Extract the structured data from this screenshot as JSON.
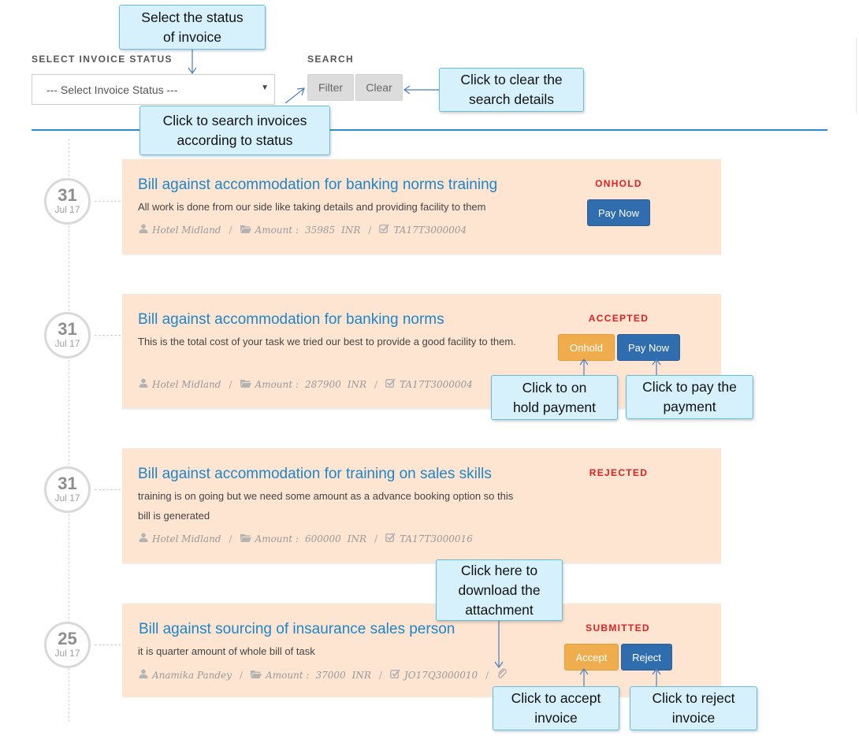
{
  "filters": {
    "status_label": "SELECT INVOICE STATUS",
    "status_select_value": "--- Select Invoice Status ---",
    "search_label": "SEARCH",
    "filter_button": "Filter",
    "clear_button": "Clear"
  },
  "invoices": [
    {
      "day": "31",
      "month": "Jul 17",
      "title": "Bill against accommodation for banking norms training",
      "description": "All work is done from our side like taking details and providing facility to them",
      "vendor": "Hotel Midland",
      "amount_label": "Amount :",
      "amount": "35985",
      "currency": "INR",
      "ref": "TA17T3000004",
      "status": "ONHOLD",
      "actions": [
        "Pay Now"
      ]
    },
    {
      "day": "31",
      "month": "Jul 17",
      "title": "Bill against accommodation for banking norms",
      "description": "This is the total cost of your task we tried our best to provide a good facility to them.",
      "vendor": "Hotel Midland",
      "amount_label": "Amount :",
      "amount": "287900",
      "currency": "INR",
      "ref": "TA17T3000004",
      "status": "ACCEPTED",
      "actions": [
        "Onhold",
        "Pay Now"
      ]
    },
    {
      "day": "31",
      "month": "Jul 17",
      "title": "Bill against accommodation for training on sales skills",
      "description": "training is on going but we need some amount as a advance booking option so this bill is generated",
      "vendor": "Hotel Midland",
      "amount_label": "Amount :",
      "amount": "600000",
      "currency": "INR",
      "ref": "TA17T3000016",
      "status": "REJECTED",
      "actions": []
    },
    {
      "day": "25",
      "month": "Jul 17",
      "title": "Bill against sourcing of insaurance sales person",
      "description": "it is quarter amount of whole bill of task",
      "vendor": "Anamika Pandey",
      "amount_label": "Amount :",
      "amount": "37000",
      "currency": "INR",
      "ref": "JO17Q3000010",
      "status": "SUBMITTED",
      "actions": [
        "Accept",
        "Reject"
      ]
    }
  ],
  "callouts": {
    "select_status": "Select  the status of invoice",
    "search": "Click to search invoices according to status",
    "clear": "Click to clear the search details",
    "onhold": "Click to on hold payment",
    "pay": "Click to pay the payment",
    "download": "Click here to download the attachment",
    "accept": "Click to accept invoice",
    "reject": "Click to reject invoice"
  },
  "colors": {
    "accent_blue": "#1e86c8",
    "card_background": "#fde5d2",
    "status_red": "#e02020",
    "button_blue": "#2f6dae",
    "button_orange": "#efad4e",
    "callout_fill": "#d6f1fb"
  },
  "icons": [
    "user-icon",
    "folder-icon",
    "check-square-icon",
    "paperclip-icon"
  ]
}
